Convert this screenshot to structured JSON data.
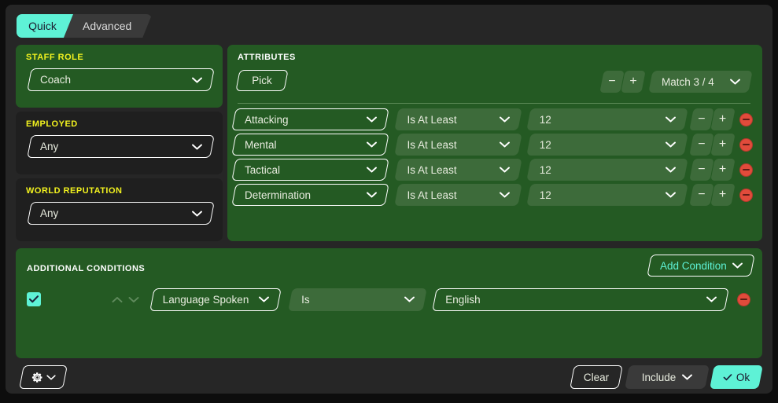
{
  "tabs": [
    {
      "label": "Quick",
      "active": true
    },
    {
      "label": "Advanced",
      "active": false
    }
  ],
  "staff_role": {
    "label": "STAFF ROLE",
    "value": "Coach"
  },
  "employed": {
    "label": "EMPLOYED",
    "value": "Any"
  },
  "world_reputation": {
    "label": "WORLD REPUTATION",
    "value": "Any"
  },
  "attributes": {
    "label": "ATTRIBUTES",
    "pick_label": "Pick",
    "match_label": "Match 3 / 4",
    "minus_label": "−",
    "plus_label": "+",
    "rows": [
      {
        "attribute": "Attacking",
        "comparator": "Is At Least",
        "value": "12"
      },
      {
        "attribute": "Mental",
        "comparator": "Is At Least",
        "value": "12"
      },
      {
        "attribute": "Tactical",
        "comparator": "Is At Least",
        "value": "12"
      },
      {
        "attribute": "Determination",
        "comparator": "Is At Least",
        "value": "12"
      }
    ]
  },
  "additional_conditions": {
    "label": "ADDITIONAL CONDITIONS",
    "add_condition_label": "Add Condition",
    "rows": [
      {
        "enabled": true,
        "field": "Language Spoken",
        "operator": "Is",
        "value": "English"
      }
    ]
  },
  "bottom_bar": {
    "settings_icon": "gear-icon",
    "clear_label": "Clear",
    "include_label": "Include",
    "ok_label": "Ok"
  },
  "colors": {
    "accent_cyan": "#5ef2d6",
    "panel_green": "#245a23",
    "control_green": "#3d6b3a",
    "label_yellow": "#f2f21f",
    "remove_red": "#e14b3b",
    "window_bg": "#262626",
    "panel_dark": "#1f1f1f"
  }
}
